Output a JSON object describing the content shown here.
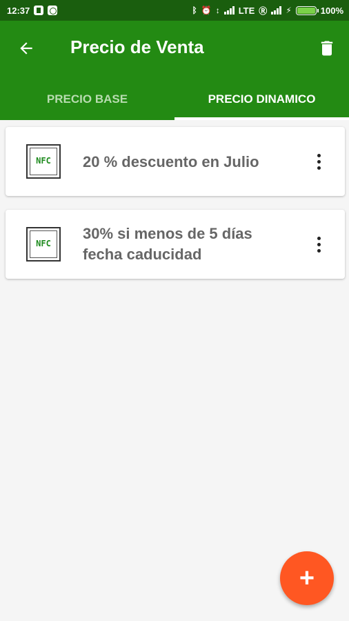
{
  "status_bar": {
    "time": "12:37",
    "network": "LTE",
    "battery": "100%"
  },
  "toolbar": {
    "title": "Precio de Venta"
  },
  "tabs": [
    {
      "label": "PRECIO BASE",
      "active": false
    },
    {
      "label": "PRECIO DINAMICO",
      "active": true
    }
  ],
  "items": [
    {
      "icon": "nfc-icon",
      "icon_text": "NFC",
      "text": "20 % descuento en Julio"
    },
    {
      "icon": "nfc-icon",
      "icon_text": "NFC",
      "text": "30% si menos de 5 días fecha caducidad"
    }
  ],
  "fab": {
    "label": "+"
  },
  "colors": {
    "status_bar": "#1a5e0e",
    "app_bar": "#238a13",
    "fab": "#ff5722",
    "nfc_text": "#1d8a1d"
  }
}
